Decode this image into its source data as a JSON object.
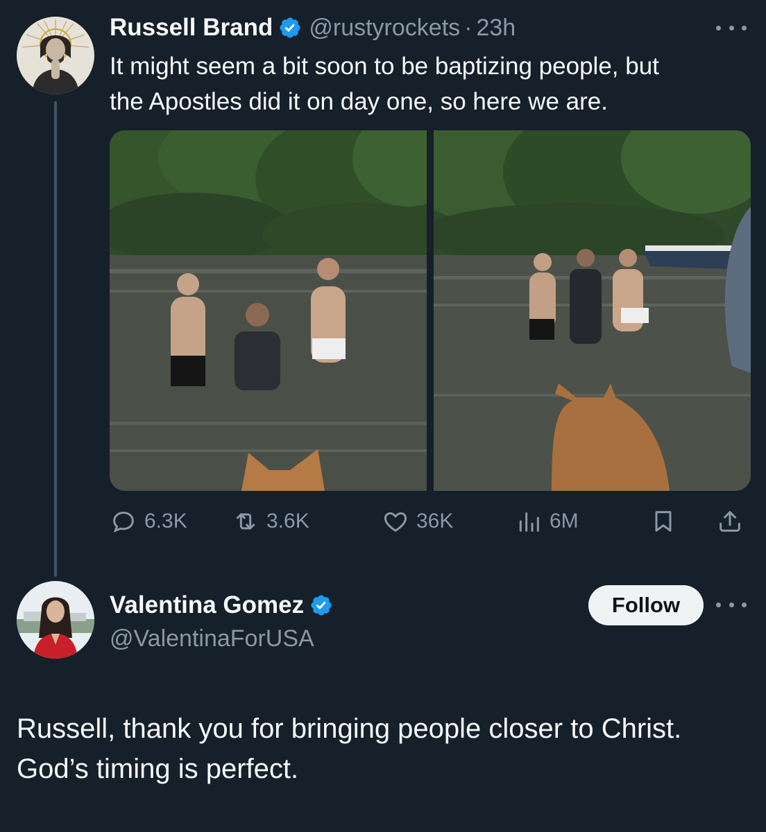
{
  "original_tweet": {
    "display_name": "Russell Brand",
    "handle": "@rustyrockets",
    "separator": "·",
    "time": "23h",
    "text": "It might seem a bit soon to be baptizing people, but\nthe Apostles did it on day one, so here we are.",
    "verified": true,
    "avatar_icon": "portrait-with-halo",
    "media": [
      {
        "icon": "river-baptism-photo-1"
      },
      {
        "icon": "river-baptism-photo-2"
      }
    ],
    "actions": {
      "replies": "6.3K",
      "reposts": "3.6K",
      "likes": "36K",
      "views": "6M"
    }
  },
  "reply_tweet": {
    "display_name": "Valentina Gomez",
    "handle": "@ValentinaForUSA",
    "verified": true,
    "follow_label": "Follow",
    "text": "Russell, thank you for bringing people closer to Christ.\nGod’s timing is perfect."
  },
  "colors": {
    "background": "#15202b",
    "text_primary": "#f7f9f9",
    "text_secondary": "#8b98a5",
    "verified_blue": "#1d9bf0",
    "thread_line": "#425364",
    "follow_button_bg": "#eff3f4"
  }
}
